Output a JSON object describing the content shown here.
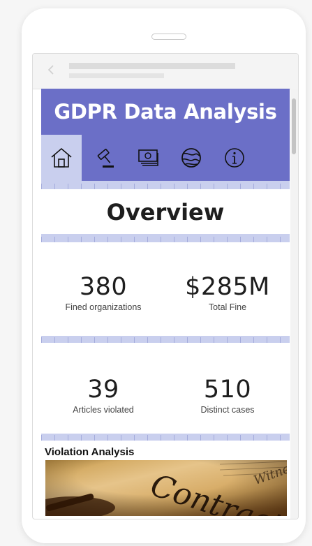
{
  "report": {
    "title": "GDPR Data Analysis",
    "nav": [
      {
        "icon": "home-icon",
        "active": true
      },
      {
        "icon": "gavel-icon",
        "active": false
      },
      {
        "icon": "money-icon",
        "active": false
      },
      {
        "icon": "globe-icon",
        "active": false
      },
      {
        "icon": "info-icon",
        "active": false
      }
    ],
    "overview_title": "Overview",
    "kpis": [
      {
        "value": "380",
        "label": "Fined organizations"
      },
      {
        "value": "$285M",
        "label": "Total Fine"
      },
      {
        "value": "39",
        "label": "Articles violated"
      },
      {
        "value": "510",
        "label": "Distinct cases"
      }
    ],
    "violation_section": {
      "title": "Violation Analysis",
      "image_text": "Contract"
    }
  },
  "colors": {
    "banner": "#6b6fc7",
    "background": "#c9cfee",
    "card": "#ffffff"
  }
}
